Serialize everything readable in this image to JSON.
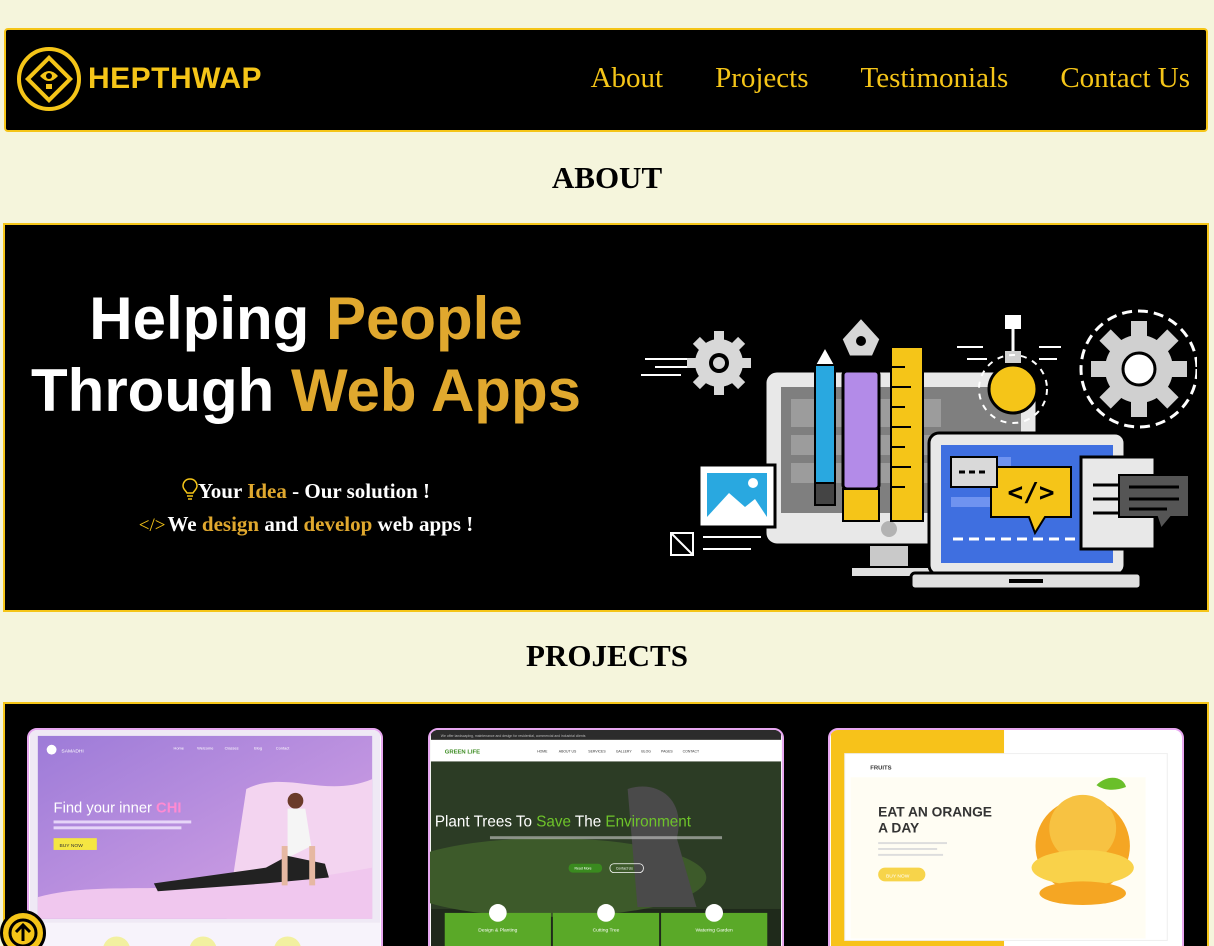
{
  "brand": {
    "name": "HEPTHWAP",
    "accent": "#f5c518",
    "gold_text": "#e0a82e",
    "page_bg": "#f5f5dc"
  },
  "nav": {
    "items": [
      "About",
      "Projects",
      "Testimonials",
      "Contact Us"
    ]
  },
  "about": {
    "section_title": "ABOUT",
    "heading_line1_white": "Helping ",
    "heading_line1_gold": "People",
    "heading_line2_white": "Through ",
    "heading_line2_gold": "Web Apps",
    "tagline1": {
      "icon": "lightbulb-icon",
      "a": "Your ",
      "b": "Idea",
      "c": " - Our solution !"
    },
    "tagline2": {
      "icon": "code-icon",
      "a": "We ",
      "b": "design",
      "c": " and ",
      "d": "develop",
      "e": " web apps !"
    }
  },
  "projects": {
    "section_title": "PROJECTS",
    "cards": [
      {
        "brand": "SAMADHI",
        "nav": [
          "Home",
          "Welcome",
          "Classes",
          "Blog",
          "Contact"
        ],
        "headline_a": "Find your inner ",
        "headline_b": "CHI",
        "button": "BUY NOW"
      },
      {
        "topbar": "We offer landscaping, maintenance and design for residential, commercial and industrial clients",
        "brand": "GREEN LIFE",
        "nav": [
          "HOME",
          "ABOUT US",
          "SERVICES",
          "GALLERY",
          "BLOG",
          "PAGES",
          "CONTACT"
        ],
        "headline_a": "Plant Trees To ",
        "headline_b": "Save",
        "headline_c": " The ",
        "headline_d": "Environment",
        "btn_primary": "Read More",
        "btn_secondary": "Contact Us",
        "features": [
          "Design & Planting",
          "Cutting Tree",
          "Watering Garden"
        ]
      },
      {
        "brand": "FRUITS",
        "headline_line1": "EAT AN ORANGE",
        "headline_line2": "A DAY",
        "button": "BUY NOW"
      }
    ]
  },
  "scroll_button": {
    "icon": "arrow-up-icon"
  }
}
